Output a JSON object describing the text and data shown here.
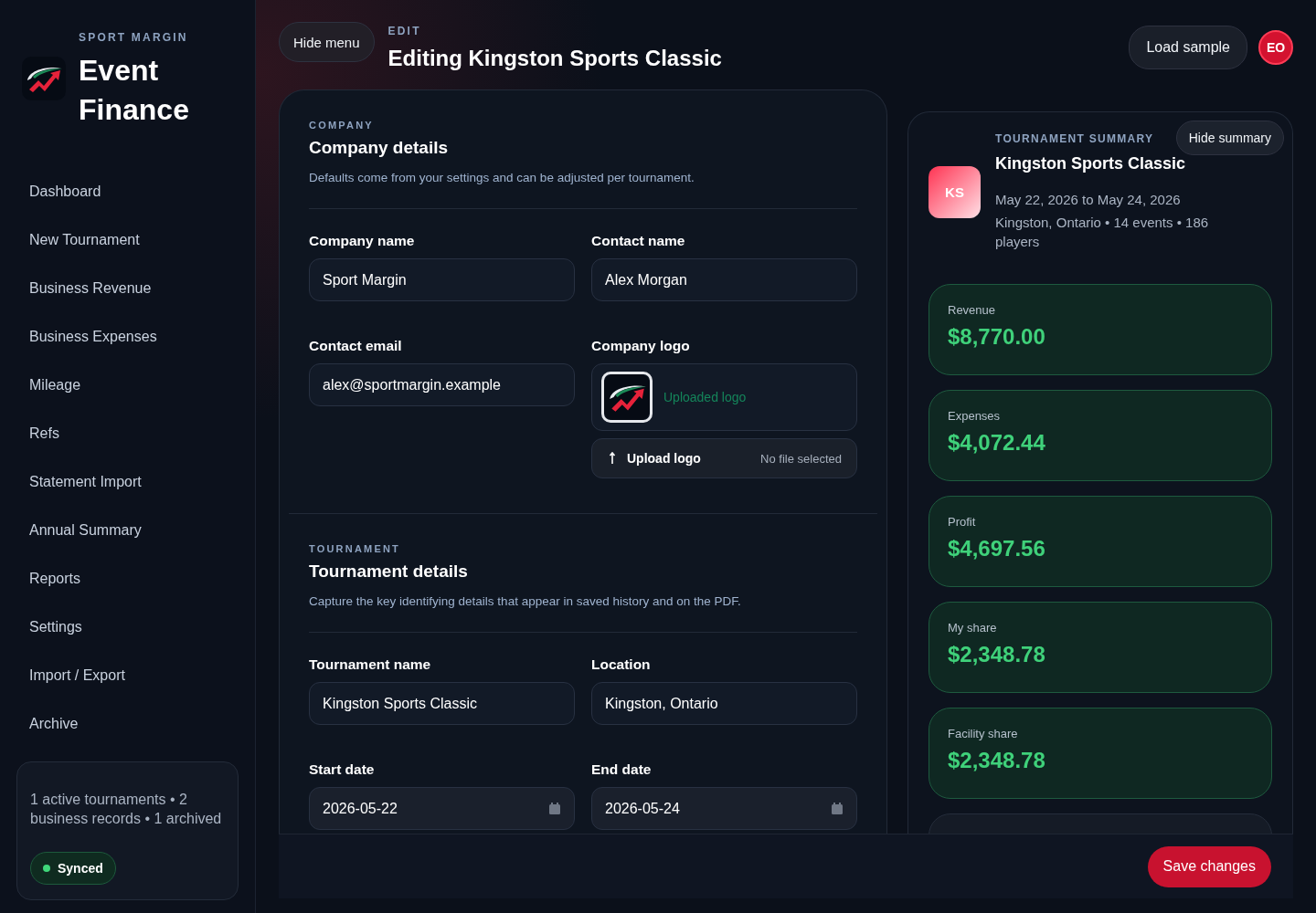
{
  "brand": {
    "eyebrow": "SPORT MARGIN",
    "title_lines": [
      "Event",
      "Finance"
    ]
  },
  "nav": [
    {
      "label": "Dashboard"
    },
    {
      "label": "New Tournament"
    },
    {
      "label": "Business Revenue"
    },
    {
      "label": "Business Expenses"
    },
    {
      "label": "Mileage"
    },
    {
      "label": "Refs"
    },
    {
      "label": "Statement Import"
    },
    {
      "label": "Annual Summary"
    },
    {
      "label": "Reports"
    },
    {
      "label": "Settings"
    },
    {
      "label": "Import / Export"
    },
    {
      "label": "Archive"
    }
  ],
  "sidebar_status": {
    "text": "1 active tournaments • 2 business records • 1 archived",
    "badge": "Synced",
    "synced": true
  },
  "header": {
    "menu_button": "Hide menu",
    "eyebrow": "EDIT",
    "title": "Editing Kingston Sports Classic",
    "load_button": "Load sample",
    "avatar": "EO"
  },
  "sections": [
    {
      "eyebrow": "COMPANY",
      "title": "Company details",
      "description": "Defaults come from your settings and can be adjusted per tournament.",
      "fields": [
        {
          "kind": "text",
          "label": "Company name",
          "value": "Sport Margin"
        },
        {
          "kind": "text",
          "label": "Contact name",
          "value": "Alex Morgan"
        },
        {
          "kind": "text",
          "label": "Contact email",
          "value": "alex@sportmargin.example"
        },
        {
          "kind": "logo",
          "label": "Company logo",
          "status": "Uploaded logo",
          "upload_button": "Upload logo",
          "file_status": "No file selected"
        }
      ]
    },
    {
      "eyebrow": "TOURNAMENT",
      "title": "Tournament details",
      "description": "Capture the key identifying details that appear in saved history and on the PDF.",
      "fields": [
        {
          "kind": "text",
          "label": "Tournament name",
          "value": "Kingston Sports Classic"
        },
        {
          "kind": "text",
          "label": "Location",
          "value": "Kingston, Ontario"
        },
        {
          "kind": "date",
          "label": "Start date",
          "value": "2026-05-22"
        },
        {
          "kind": "date",
          "label": "End date",
          "value": "2026-05-24"
        }
      ]
    }
  ],
  "summary": {
    "eyebrow": "TOURNAMENT SUMMARY",
    "hide_button": "Hide summary",
    "badge": "KS",
    "title": "Kingston Sports Classic",
    "dates": "May 22, 2026 to May 24, 2026",
    "details": "Kingston, Ontario • 14 events • 186 players",
    "metrics": [
      {
        "kind": "highlight",
        "label": "Revenue",
        "value": "$8,770.00"
      },
      {
        "kind": "highlight",
        "label": "Expenses",
        "value": "$4,072.44"
      },
      {
        "kind": "highlight",
        "label": "Profit",
        "value": "$4,697.56"
      },
      {
        "kind": "highlight",
        "label": "My share",
        "value": "$2,348.78"
      },
      {
        "kind": "highlight",
        "label": "Facility share",
        "value": "$2,348.78"
      },
      {
        "kind": "plain"
      }
    ]
  },
  "footer": {
    "save_button": "Save changes"
  }
}
